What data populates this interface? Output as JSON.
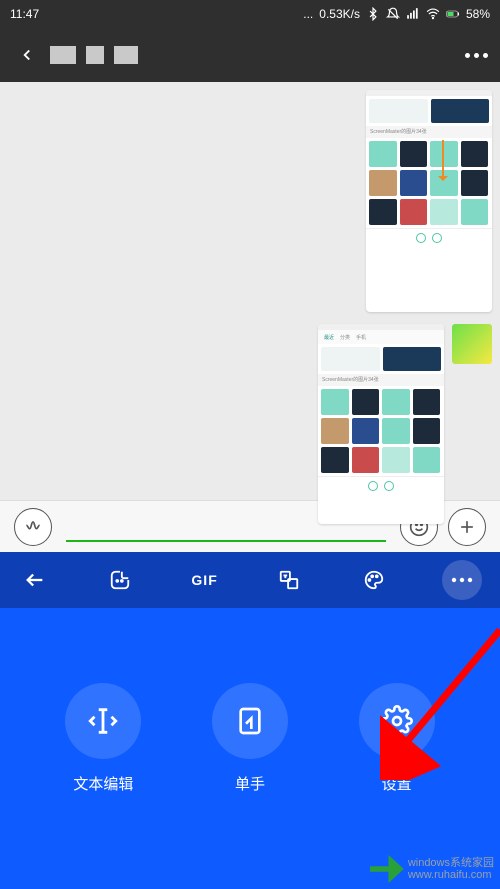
{
  "status": {
    "time": "11:47",
    "speed": "0.53K/s",
    "battery_pct": "58%",
    "icons": [
      "dots",
      "bluetooth",
      "dnd",
      "signal",
      "wifi",
      "battery"
    ]
  },
  "topbar": {
    "back_icon": "chevron-left",
    "title_obscured": true,
    "more_icon": "more-horizontal"
  },
  "chat": {
    "messages": [
      {
        "type": "image-thumbnail",
        "self": true
      },
      {
        "type": "image-thumbnail",
        "self": true
      }
    ],
    "mini_tabs": [
      "最近",
      "分类",
      "手机"
    ],
    "mini_band": "ScreenMaster的图片34张"
  },
  "input_bar": {
    "voice_icon": "voice",
    "emoji_icon": "smile",
    "add_icon": "plus"
  },
  "kb_toolbar": {
    "back_icon": "arrow-left",
    "sticker_icon": "sticker",
    "gif_label": "GIF",
    "translate_icon": "translate",
    "palette_icon": "palette",
    "more_icon": "more-horizontal"
  },
  "kb_panel": {
    "actions": [
      {
        "icon": "text-cursor",
        "label": "文本编辑"
      },
      {
        "icon": "one-hand",
        "label": "单手"
      },
      {
        "icon": "gear",
        "label": "设置"
      }
    ]
  },
  "watermark": {
    "line1": "windows系统家园",
    "line2": "www.ruhaifu.com"
  },
  "annotation": {
    "arrow_target": "settings-button"
  }
}
